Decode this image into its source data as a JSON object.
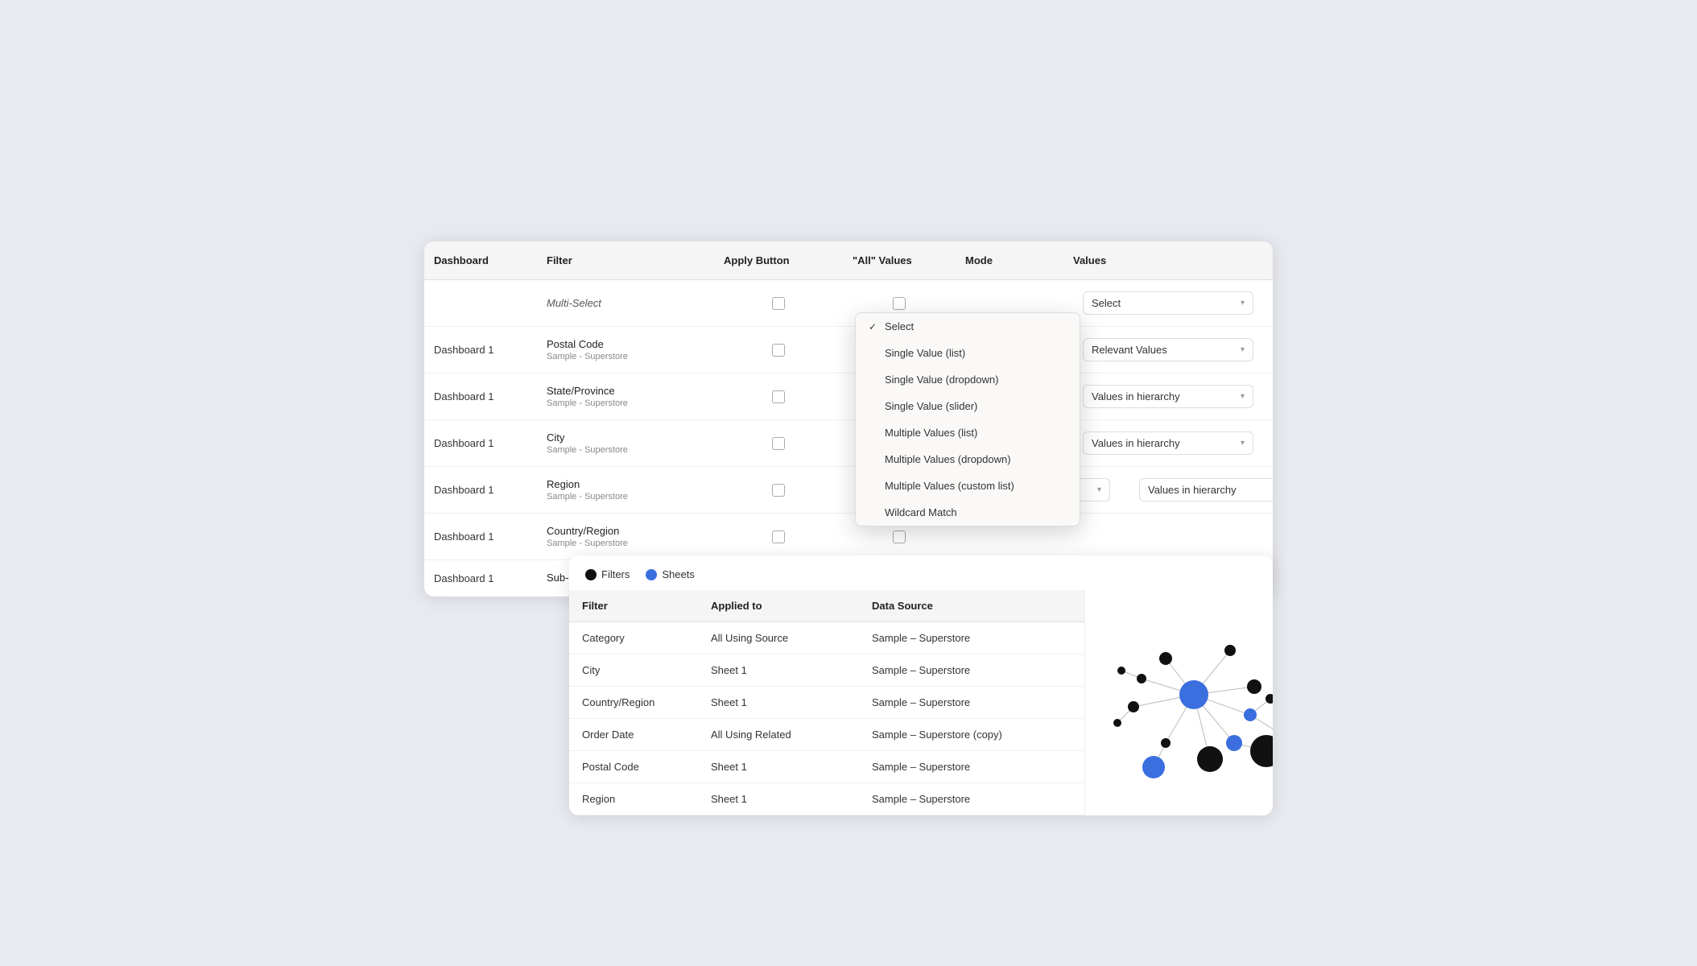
{
  "table": {
    "headers": {
      "dashboard": "Dashboard",
      "filter": "Filter",
      "applyButton": "Apply Button",
      "allValues": "\"All\" Values",
      "mode": "Mode",
      "values": "Values"
    },
    "rows": [
      {
        "id": "multiselect",
        "dashboard": "",
        "filter": "Multi-Select",
        "filterSub": "",
        "applyButton": false,
        "allValues": false,
        "mode": "",
        "modeLabel": "",
        "values": "Select",
        "italic": true
      },
      {
        "id": "postal",
        "dashboard": "Dashboard 1",
        "filter": "Postal Code",
        "filterSub": "Sample - Superstore",
        "applyButton": false,
        "allValues": true,
        "mode": "dropdown",
        "modeLabel": "",
        "values": "Relevant Values"
      },
      {
        "id": "state",
        "dashboard": "Dashboard 1",
        "filter": "State/Province",
        "filterSub": "Sample - Superstore",
        "applyButton": false,
        "allValues": true,
        "mode": "dropdown",
        "modeLabel": "",
        "values": "Values in hierarchy"
      },
      {
        "id": "city",
        "dashboard": "Dashboard 1",
        "filter": "City",
        "filterSub": "Sample - Superstore",
        "applyButton": false,
        "allValues": true,
        "mode": "dropdown",
        "modeLabel": "",
        "values": "Values in hierarchy"
      },
      {
        "id": "region",
        "dashboard": "Dashboard 1",
        "filter": "Region",
        "filterSub": "Sample - Superstore",
        "applyButton": false,
        "allValues": false,
        "mode": "shown",
        "modeLabel": "Multiple Values (list)",
        "values": "Values in hierarchy"
      },
      {
        "id": "country",
        "dashboard": "Dashboard 1",
        "filter": "Country/Region",
        "filterSub": "Sample - Superstore",
        "applyButton": false,
        "allValues": false,
        "mode": "dropdown",
        "modeLabel": "",
        "values": ""
      },
      {
        "id": "subcategory",
        "dashboard": "Dashboard 1",
        "filter": "Sub-Category",
        "filterSub": "",
        "applyButton": false,
        "allValues": false,
        "mode": "",
        "modeLabel": "",
        "values": ""
      }
    ]
  },
  "dropdown": {
    "items": [
      {
        "label": "Select",
        "selected": true
      },
      {
        "label": "Single Value (list)",
        "selected": false
      },
      {
        "label": "Single Value (dropdown)",
        "selected": false
      },
      {
        "label": "Single Value (slider)",
        "selected": false
      },
      {
        "label": "Multiple Values (list)",
        "selected": false
      },
      {
        "label": "Multiple Values (dropdown)",
        "selected": false
      },
      {
        "label": "Multiple Values (custom list)",
        "selected": false
      },
      {
        "label": "Wildcard Match",
        "selected": false
      }
    ]
  },
  "bottomCard": {
    "legend": {
      "filters": "Filters",
      "sheets": "Sheets"
    },
    "table": {
      "headers": [
        "Filter",
        "Applied to",
        "Data Source"
      ],
      "rows": [
        {
          "filter": "Category",
          "appliedTo": "All Using Source",
          "dataSource": "Sample – Superstore"
        },
        {
          "filter": "City",
          "appliedTo": "Sheet 1",
          "dataSource": "Sample – Superstore"
        },
        {
          "filter": "Country/Region",
          "appliedTo": "Sheet 1",
          "dataSource": "Sample – Superstore"
        },
        {
          "filter": "Order Date",
          "appliedTo": "All Using Related",
          "dataSource": "Sample – Superstore (copy)"
        },
        {
          "filter": "Postal Code",
          "appliedTo": "Sheet 1",
          "dataSource": "Sample – Superstore"
        },
        {
          "filter": "Region",
          "appliedTo": "Sheet 1",
          "dataSource": "Sample – Superstore"
        }
      ]
    }
  }
}
